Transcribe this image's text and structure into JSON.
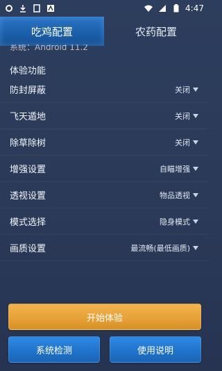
{
  "status_bar": {
    "time": "4:47",
    "left_icons": [
      "gear-icon",
      "download-icon",
      "sim-icon",
      "app-icon"
    ],
    "right_icons": [
      "wifi-icon",
      "signal-icon",
      "battery-icon"
    ]
  },
  "tabs": [
    {
      "label": "吃鸡配置",
      "active": true
    },
    {
      "label": "农药配置",
      "active": false
    }
  ],
  "scroll_peek_text": "系统：Android 11.2",
  "section_title": "体验功能",
  "settings": [
    {
      "label": "防封屏蔽",
      "value": "关闭"
    },
    {
      "label": "飞天遁地",
      "value": "关闭"
    },
    {
      "label": "除草除树",
      "value": "关闭"
    },
    {
      "label": "增强设置",
      "value": "自瞄增强"
    },
    {
      "label": "透视设置",
      "value": "物品透视"
    },
    {
      "label": "模式选择",
      "value": "隐身模式"
    },
    {
      "label": "画质设置",
      "value": "最流畅(最低画质)"
    }
  ],
  "buttons": {
    "start": "开始体验",
    "system_check": "系统检测",
    "instructions": "使用说明"
  },
  "colors": {
    "background": "#2b3a58",
    "active_tab": "#1b5ea8",
    "start_button": "#e6a037",
    "blue_button": "#1f72c9"
  }
}
